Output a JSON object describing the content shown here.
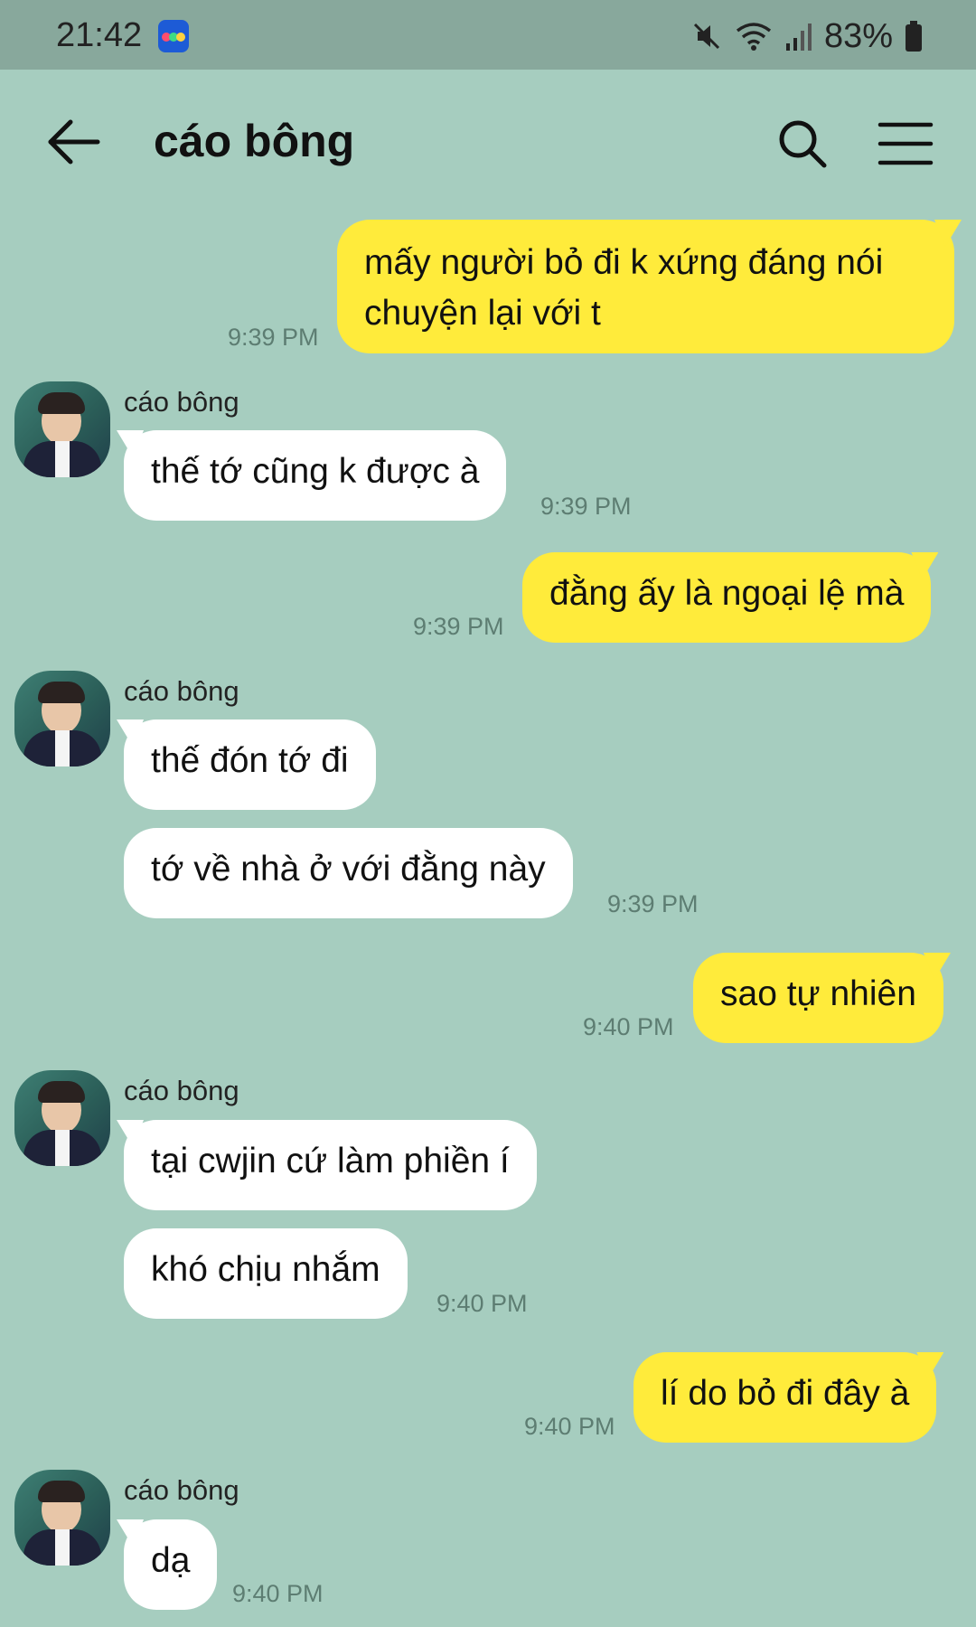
{
  "status_bar": {
    "time": "21:42",
    "battery": "83%",
    "icons": [
      "mute-icon",
      "wifi-icon",
      "signal-icon",
      "battery-icon"
    ]
  },
  "header": {
    "title": "cáo bông",
    "back_icon": "back-arrow-icon",
    "search_icon": "search-icon",
    "menu_icon": "menu-icon"
  },
  "colors": {
    "chat_background": "#a6cdbf",
    "outgoing_bubble": "#ffeb3b",
    "incoming_bubble": "#ffffff",
    "status_bar": "#88a89c"
  },
  "messages": [
    {
      "text_line1": "mấy người bỏ đi k xứng đáng nói",
      "text_line2": "chuyện lại với t",
      "time": "9:39 PM"
    },
    {
      "sender": "cáo bông",
      "text": "thế tớ cũng k được à",
      "time": "9:39 PM"
    },
    {
      "text": "đằng ấy là ngoại lệ mà",
      "time": "9:39 PM"
    },
    {
      "sender": "cáo bông",
      "text": "thế đón tớ đi"
    },
    {
      "text": "tớ về nhà ở với đằng này",
      "time": "9:39 PM"
    },
    {
      "text": "sao tự nhiên",
      "time": "9:40 PM"
    },
    {
      "sender": "cáo bông",
      "text": "tại cwjin cứ làm phiền í"
    },
    {
      "text": "khó chịu nhắm",
      "time": "9:40 PM"
    },
    {
      "text": "lí do bỏ đi đây à",
      "time": "9:40 PM"
    },
    {
      "sender": "cáo bông",
      "text": "dạ",
      "time": "9:40 PM"
    }
  ]
}
